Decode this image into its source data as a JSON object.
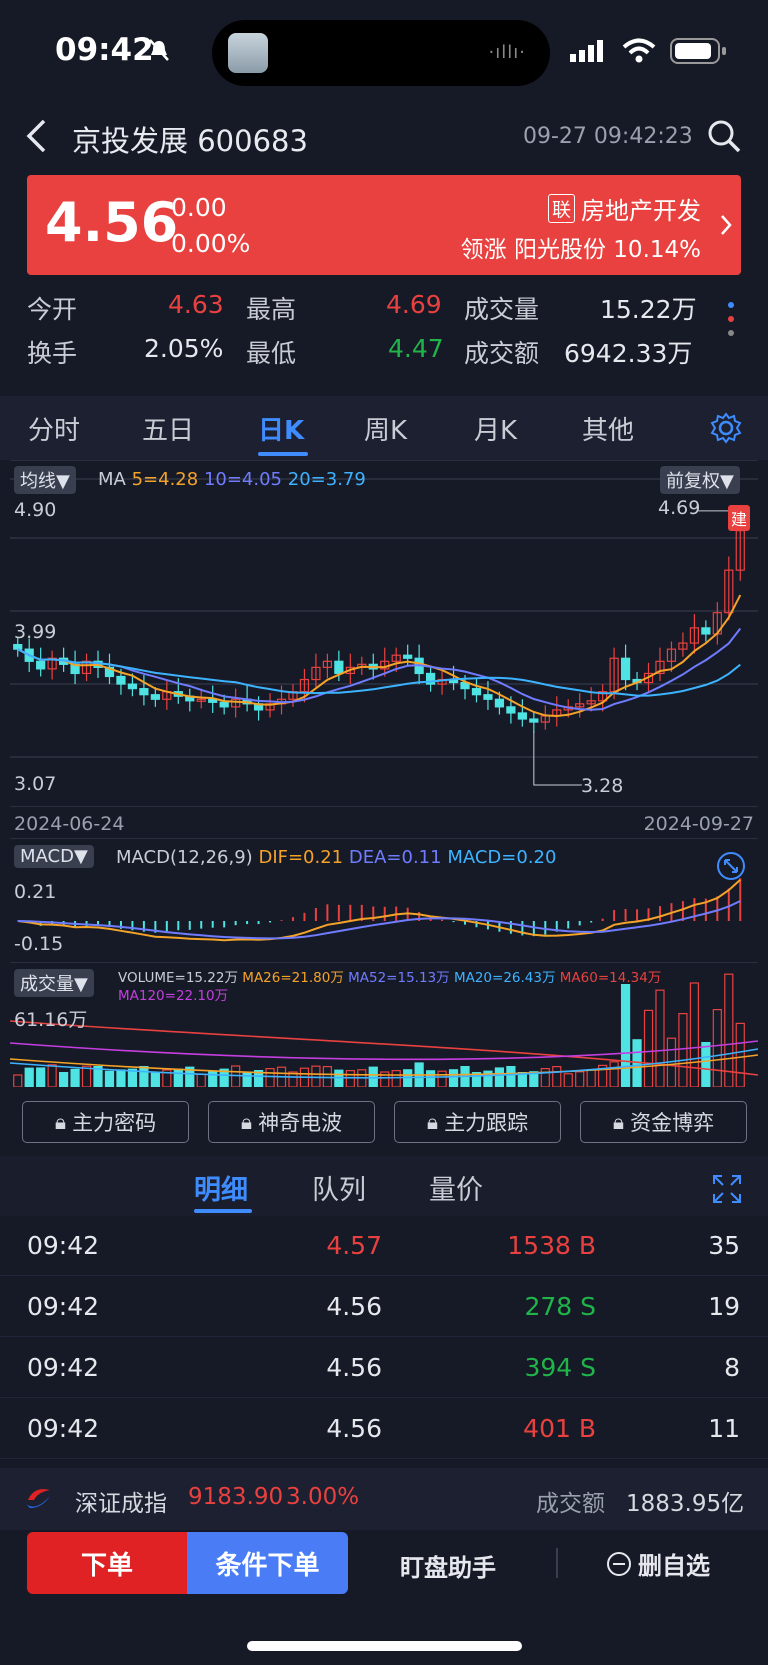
{
  "status": {
    "time": "09:42"
  },
  "header": {
    "title": "京投发展 600683",
    "datetime": "09-27 09:42:23"
  },
  "quote": {
    "price": "4.56",
    "change": "0.00",
    "change_pct": "0.00%",
    "sector_tag": "联",
    "sector": "房地产开发",
    "leader_label": "领涨",
    "leader_name": "阳光股份",
    "leader_pct": "10.14%",
    "colors": {
      "banner": "#e8413f",
      "up": "#e8413f",
      "down": "#20b44a"
    }
  },
  "stats": {
    "open_label": "今开",
    "open": "4.63",
    "high_label": "最高",
    "high": "4.69",
    "vol_label": "成交量",
    "vol": "15.22万",
    "turnover_label": "换手",
    "turnover": "2.05%",
    "low_label": "最低",
    "low": "4.47",
    "amount_label": "成交额",
    "amount": "6942.33万"
  },
  "tabs": [
    "分时",
    "五日",
    "日K",
    "周K",
    "月K",
    "其他"
  ],
  "active_tab": "日K",
  "kchart": {
    "ma_chip": "均线▼",
    "ma_title": "MA",
    "ma5": "5=4.28",
    "ma10": "10=4.05",
    "ma20": "20=3.79",
    "adjust": "前复权▼",
    "y_top": "4.90",
    "y_mid": "3.99",
    "y_bottom": "3.07",
    "high_mark": "4.69",
    "low_mark": "3.28",
    "badge": "建",
    "date_start": "2024-06-24",
    "date_end": "2024-09-27"
  },
  "macd": {
    "chip": "MACD▼",
    "title": "MACD(12,26,9)",
    "dif": "DIF=0.21",
    "dea": "DEA=0.11",
    "macd": "MACD=0.20",
    "y_top": "0.21",
    "y_bottom": "-0.15"
  },
  "volume": {
    "chip": "成交量▼",
    "vol": "VOLUME=15.22万",
    "ma26": "MA26=21.80万",
    "ma52": "MA52=15.13万",
    "ma20": "MA20=26.43万",
    "ma60": "MA60=14.34万",
    "ma120": "MA120=22.10万",
    "y_top": "61.16万"
  },
  "tools": [
    "主力密码",
    "神奇电波",
    "主力跟踪",
    "资金博弈"
  ],
  "detail_tabs": [
    "明细",
    "队列",
    "量价"
  ],
  "trades": [
    {
      "time": "09:42",
      "price": "4.57",
      "vol": "1538 B",
      "count": "35",
      "pc": "red",
      "vc": "red"
    },
    {
      "time": "09:42",
      "price": "4.56",
      "vol": "278 S",
      "count": "19",
      "pc": "white",
      "vc": "green"
    },
    {
      "time": "09:42",
      "price": "4.56",
      "vol": "394 S",
      "count": "8",
      "pc": "white",
      "vc": "green"
    },
    {
      "time": "09:42",
      "price": "4.56",
      "vol": "401 B",
      "count": "11",
      "pc": "white",
      "vc": "red"
    }
  ],
  "index": {
    "name": "深证成指",
    "value": "9183.90",
    "pct": "3.00%",
    "amount_label": "成交额",
    "amount": "1883.95亿"
  },
  "bottom": {
    "order": "下单",
    "cond_order": "条件下单",
    "assistant": "盯盘助手",
    "remove": "删自选"
  },
  "chart_data": {
    "type": "candlestick",
    "title": "",
    "x_range": [
      "2024-06-24",
      "2024-09-27"
    ],
    "ylim": [
      3.07,
      4.9
    ],
    "marked_high": 4.69,
    "marked_low": 3.28,
    "closes": [
      3.78,
      3.7,
      3.65,
      3.72,
      3.68,
      3.62,
      3.7,
      3.66,
      3.6,
      3.55,
      3.52,
      3.48,
      3.45,
      3.5,
      3.47,
      3.44,
      3.45,
      3.43,
      3.4,
      3.45,
      3.42,
      3.38,
      3.42,
      3.45,
      3.5,
      3.58,
      3.66,
      3.7,
      3.62,
      3.66,
      3.68,
      3.65,
      3.7,
      3.74,
      3.72,
      3.62,
      3.55,
      3.58,
      3.56,
      3.52,
      3.48,
      3.45,
      3.4,
      3.36,
      3.32,
      3.3,
      3.34,
      3.38,
      3.4,
      3.42,
      3.44,
      3.5,
      3.72,
      3.58,
      3.56,
      3.62,
      3.7,
      3.78,
      3.82,
      3.92,
      3.88,
      4.02,
      4.3,
      4.56
    ]
  }
}
